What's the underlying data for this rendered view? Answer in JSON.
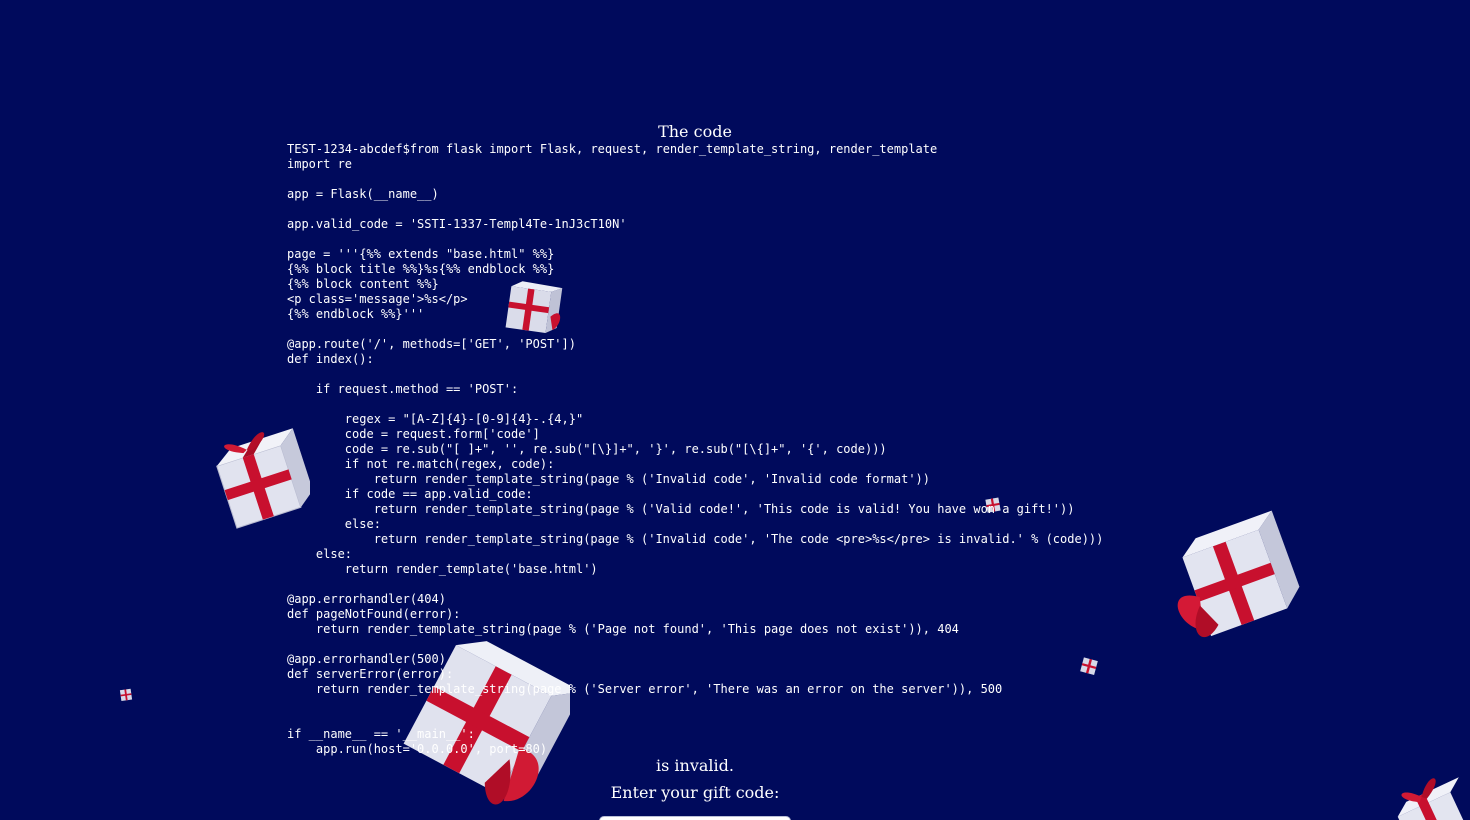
{
  "heading": "The code",
  "code_prefix": "TEST-1234-abcdef$",
  "source_lines": [
    "from flask import Flask, request, render_template_string, render_template",
    "import re",
    "",
    "app = Flask(__name__)",
    "",
    "app.valid_code = 'SSTI-1337-Templ4Te-1nJ3cT10N'",
    "",
    "page = '''{%% extends \"base.html\" %%}",
    "{%% block title %%}%s{%% endblock %%}",
    "{%% block content %%}",
    "<p class='message'>%s</p>",
    "{%% endblock %%}'''",
    "",
    "@app.route('/', methods=['GET', 'POST'])",
    "def index():",
    "",
    "    if request.method == 'POST':",
    "",
    "        regex = \"[A-Z]{4}-[0-9]{4}-.{4,}\"",
    "        code = request.form['code']",
    "        code = re.sub(\"[ ]+\", '', re.sub(\"[\\}]+\", '}', re.sub(\"[\\{]+\", '{', code)))",
    "        if not re.match(regex, code):",
    "            return render_template_string(page % ('Invalid code', 'Invalid code format'))",
    "        if code == app.valid_code:",
    "            return render_template_string(page % ('Valid code!', 'This code is valid! You have won a gift!'))",
    "        else:",
    "            return render_template_string(page % ('Invalid code', 'The code <pre>%s</pre> is invalid.' % (code)))",
    "    else:",
    "        return render_template('base.html')",
    "",
    "@app.errorhandler(404)",
    "def pageNotFound(error):",
    "    return render_template_string(page % ('Page not found', 'This page does not exist')), 404",
    "",
    "@app.errorhandler(500)",
    "def serverError(error):",
    "    return render_template_string(page % ('Server error', 'There was an error on the server')), 500",
    "",
    "",
    "if __name__ == '__main__':",
    "    app.run(host='0.0.0.0', port=80)"
  ],
  "suffix_text": "is invalid.",
  "prompt_label": "Enter your gift code:",
  "colors": {
    "background": "#000a5c",
    "text": "#ffffff",
    "gift_box": "#dfe1ee",
    "gift_ribbon": "#c8102e"
  }
}
